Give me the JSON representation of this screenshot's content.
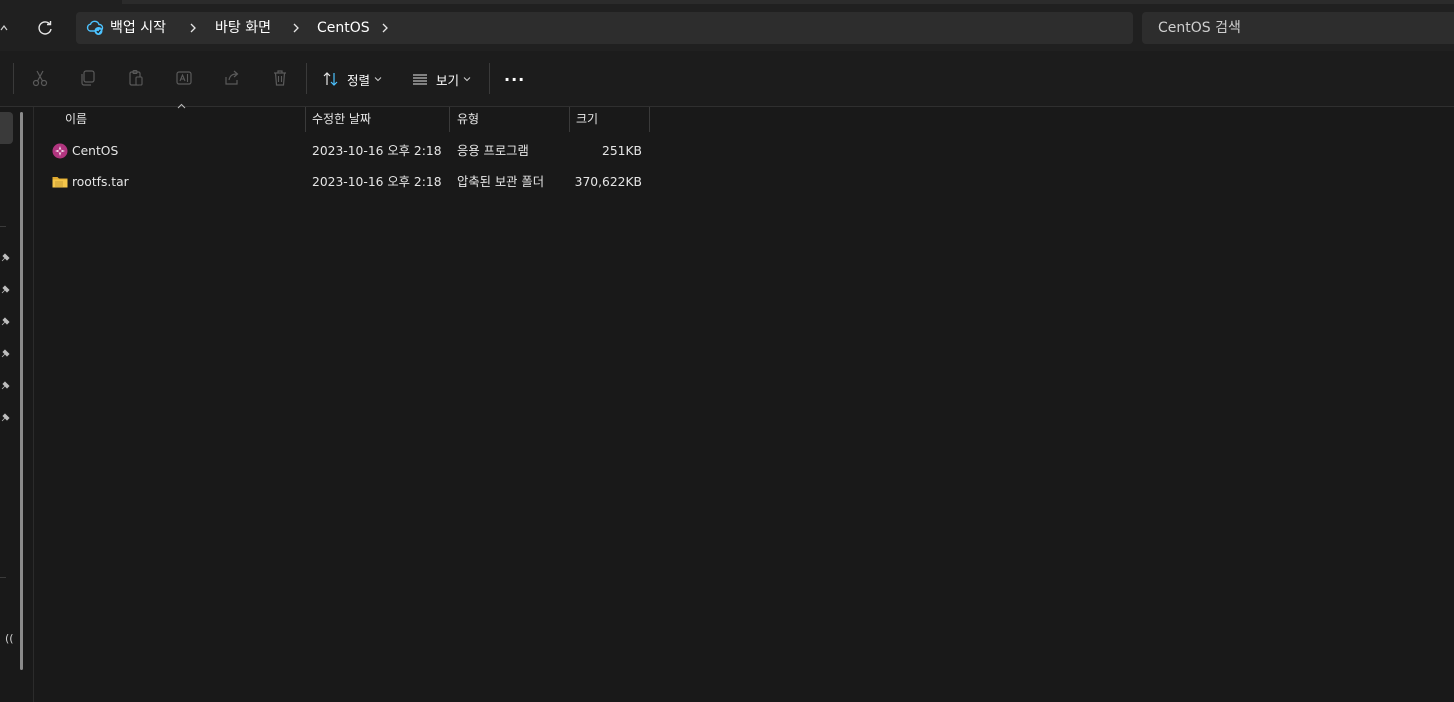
{
  "address_bar": {
    "crumbs": [
      "백업 시작",
      "바탕 화면",
      "CentOS"
    ]
  },
  "search": {
    "placeholder": "CentOS 검색"
  },
  "toolbar": {
    "sort_label": "정렬",
    "view_label": "보기",
    "more_label": "···"
  },
  "columns": {
    "name": "이름",
    "modified": "수정한 날짜",
    "type": "유형",
    "size": "크기"
  },
  "files": [
    {
      "name": "CentOS",
      "modified": "2023-10-16 오후 2:18",
      "type": "응용 프로그램",
      "size": "251KB",
      "icon": "centos-app-icon"
    },
    {
      "name": "rootfs.tar",
      "modified": "2023-10-16 오후 2:18",
      "type": "압축된 보관 폴더",
      "size": "370,622KB",
      "icon": "zip-folder-icon"
    }
  ],
  "nav": {
    "network_partial": "(("
  },
  "colors": {
    "background": "#191919",
    "chrome": "#202020",
    "field": "#2d2d2d",
    "accent_blue": "#4cc2ff",
    "centos_purple": "#b1357f",
    "folder_yellow": "#f5c64a"
  }
}
